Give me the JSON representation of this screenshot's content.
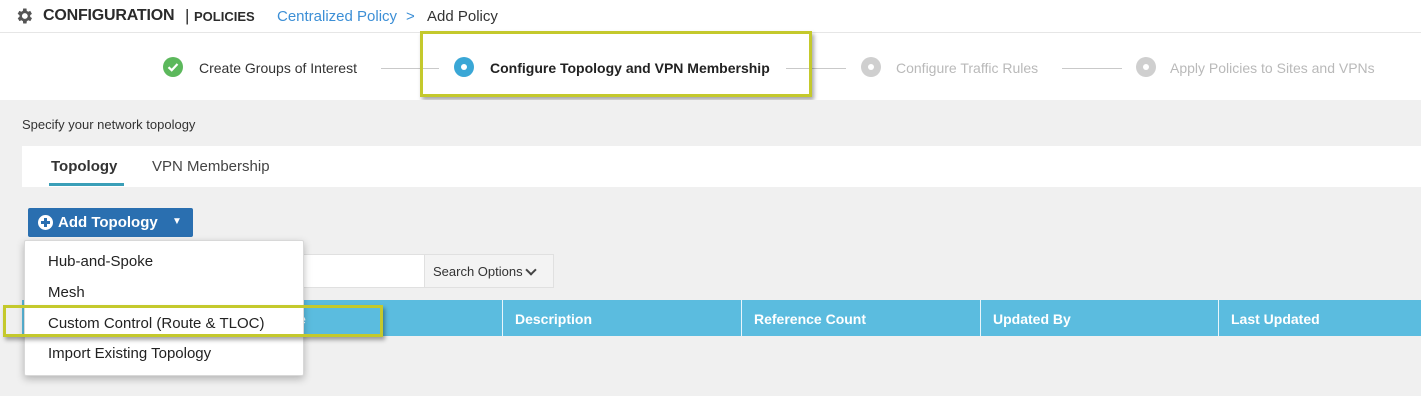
{
  "header": {
    "title": "CONFIGURATION",
    "separator": "|",
    "subtitle": "POLICIES",
    "breadcrumb_link": "Centralized Policy",
    "breadcrumb_arrow": ">",
    "breadcrumb_current": "Add Policy",
    "icon": "gear-icon"
  },
  "stepper": {
    "steps": [
      {
        "label": "Create Groups of Interest",
        "state": "done"
      },
      {
        "label": "Configure Topology and VPN Membership",
        "state": "active"
      },
      {
        "label": "Configure Traffic Rules",
        "state": "todo"
      },
      {
        "label": "Apply Policies to Sites and VPNs",
        "state": "todo"
      }
    ]
  },
  "main": {
    "instruction": "Specify your network topology",
    "tabs": [
      {
        "label": "Topology",
        "active": true
      },
      {
        "label": "VPN Membership",
        "active": false
      }
    ],
    "add_button": "Add Topology",
    "search_options": "Search Options",
    "table": {
      "columns": [
        "e",
        "Description",
        "Reference Count",
        "Updated By",
        "Last Updated"
      ]
    }
  },
  "dropdown": {
    "items": [
      "Hub-and-Spoke",
      "Mesh",
      "Custom Control (Route & TLOC)",
      "Import Existing Topology"
    ]
  },
  "colors": {
    "accent": "#2a6fb0",
    "table_header": "#5bbcdf",
    "done": "#5cb85c",
    "active": "#3aa7d6",
    "highlight": "#c4c92c"
  }
}
